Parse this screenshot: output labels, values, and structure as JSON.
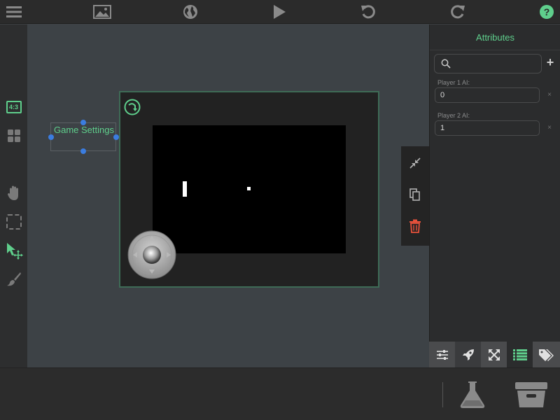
{
  "toolbar": {
    "menu_icon": "hamburger-menu-icon",
    "media_icon": "image-icon",
    "web_icon": "globe-icon",
    "play_icon": "play-icon",
    "undo_icon": "undo-icon",
    "redo_icon": "redo-icon",
    "help_icon": "help-icon"
  },
  "left_tools": {
    "aspect_label": "4:3",
    "items": [
      "aspect-ratio",
      "grid",
      "pan-hand",
      "marquee-select",
      "select-move",
      "brush"
    ]
  },
  "canvas": {
    "selected_object_label": "Game Settings"
  },
  "right_panel": {
    "title": "Attributes",
    "search_placeholder": "",
    "add_label": "+",
    "attributes": [
      {
        "label": "Player 1 AI:",
        "value": "0",
        "delete_label": "×"
      },
      {
        "label": "Player 2 AI:",
        "value": "1",
        "delete_label": "×"
      }
    ],
    "tabs": [
      "sliders",
      "rocket",
      "expand",
      "list",
      "tags"
    ]
  },
  "colors": {
    "accent_green": "#5fcf8c",
    "delete_red": "#e8513b",
    "selection_blue": "#3b7de0",
    "scene_border": "#3e6b56"
  }
}
